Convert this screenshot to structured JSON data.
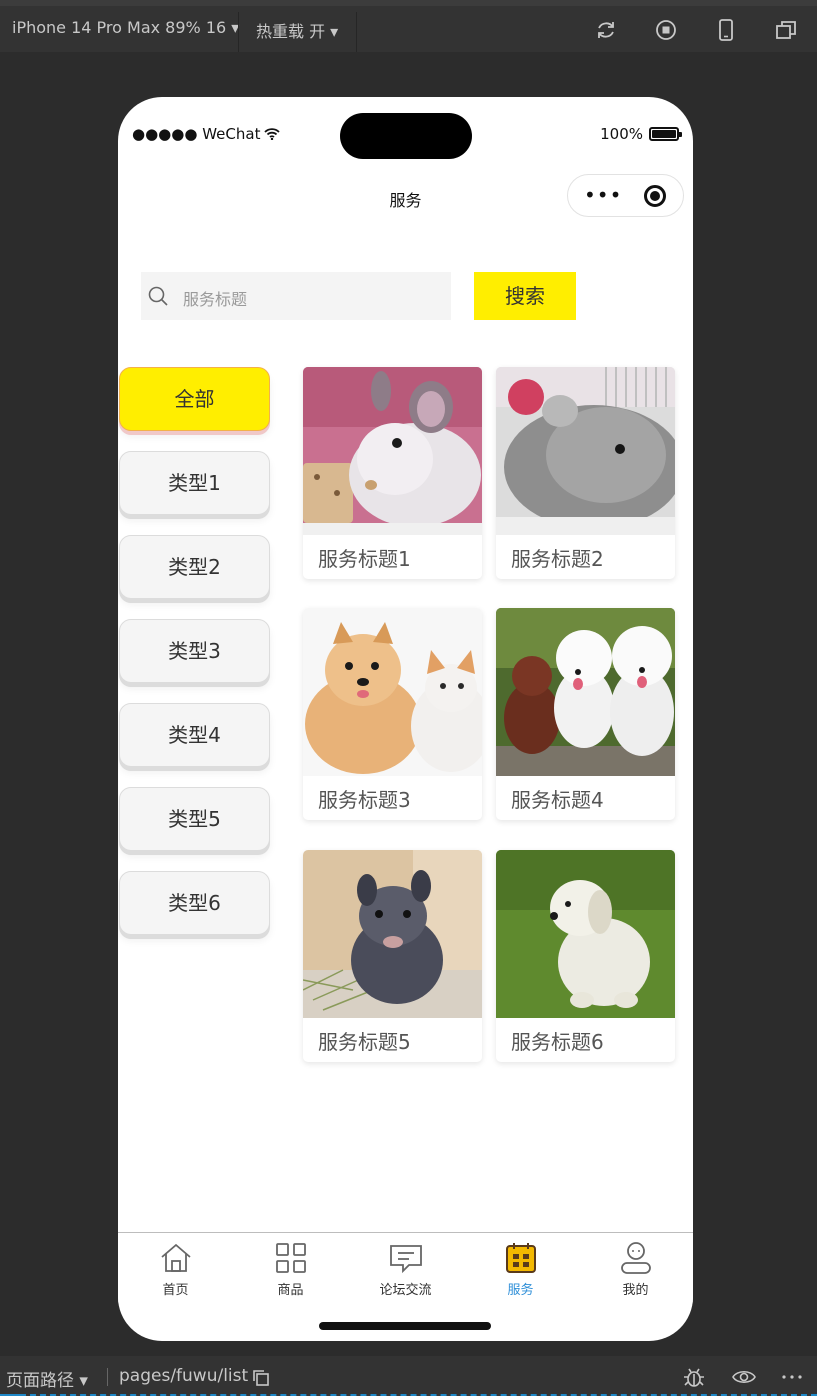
{
  "ide": {
    "device_label": "iPhone 14 Pro Max 89% 16 ▾",
    "hot_reload_label": "热重载 开 ▾",
    "toolbar_icons": [
      "refresh-icon",
      "stop-icon",
      "phone-icon",
      "window-icon"
    ],
    "page_path_label": "页面路径 ▾",
    "page_path": "pages/fuwu/list",
    "bottom_icons": [
      "bug-icon",
      "eye-icon",
      "more-icon"
    ]
  },
  "status_bar": {
    "carrier": "●●●●● WeChat",
    "battery": "100%"
  },
  "nav": {
    "title": "服务",
    "capsule_icons": [
      "more-dots-icon",
      "close-target-icon"
    ]
  },
  "search": {
    "placeholder": "服务标题",
    "button_label": "搜索"
  },
  "categories": [
    {
      "label": "全部",
      "active": true
    },
    {
      "label": "类型1",
      "active": false
    },
    {
      "label": "类型2",
      "active": false
    },
    {
      "label": "类型3",
      "active": false
    },
    {
      "label": "类型4",
      "active": false
    },
    {
      "label": "类型5",
      "active": false
    },
    {
      "label": "类型6",
      "active": false
    }
  ],
  "services": [
    {
      "title": "服务标题1",
      "image": "white-chinchilla-photo"
    },
    {
      "title": "服务标题2",
      "image": "grey-chinchilla-photo"
    },
    {
      "title": "服务标题3",
      "image": "pomeranian-and-cat-photo"
    },
    {
      "title": "服务标题4",
      "image": "three-poodles-photo"
    },
    {
      "title": "服务标题5",
      "image": "dark-chinchilla-photo"
    },
    {
      "title": "服务标题6",
      "image": "white-puppy-on-grass-photo"
    }
  ],
  "tabbar": [
    {
      "label": "首页",
      "icon": "home-icon",
      "active": false
    },
    {
      "label": "商品",
      "icon": "grid-icon",
      "active": false
    },
    {
      "label": "论坛交流",
      "icon": "chat-icon",
      "active": false
    },
    {
      "label": "服务",
      "icon": "calendar-icon",
      "active": true
    },
    {
      "label": "我的",
      "icon": "user-icon",
      "active": false
    }
  ],
  "colors": {
    "accent_yellow": "#ffee00",
    "tab_active": "#2f8fd8",
    "ide_background": "#2c2c2c"
  }
}
